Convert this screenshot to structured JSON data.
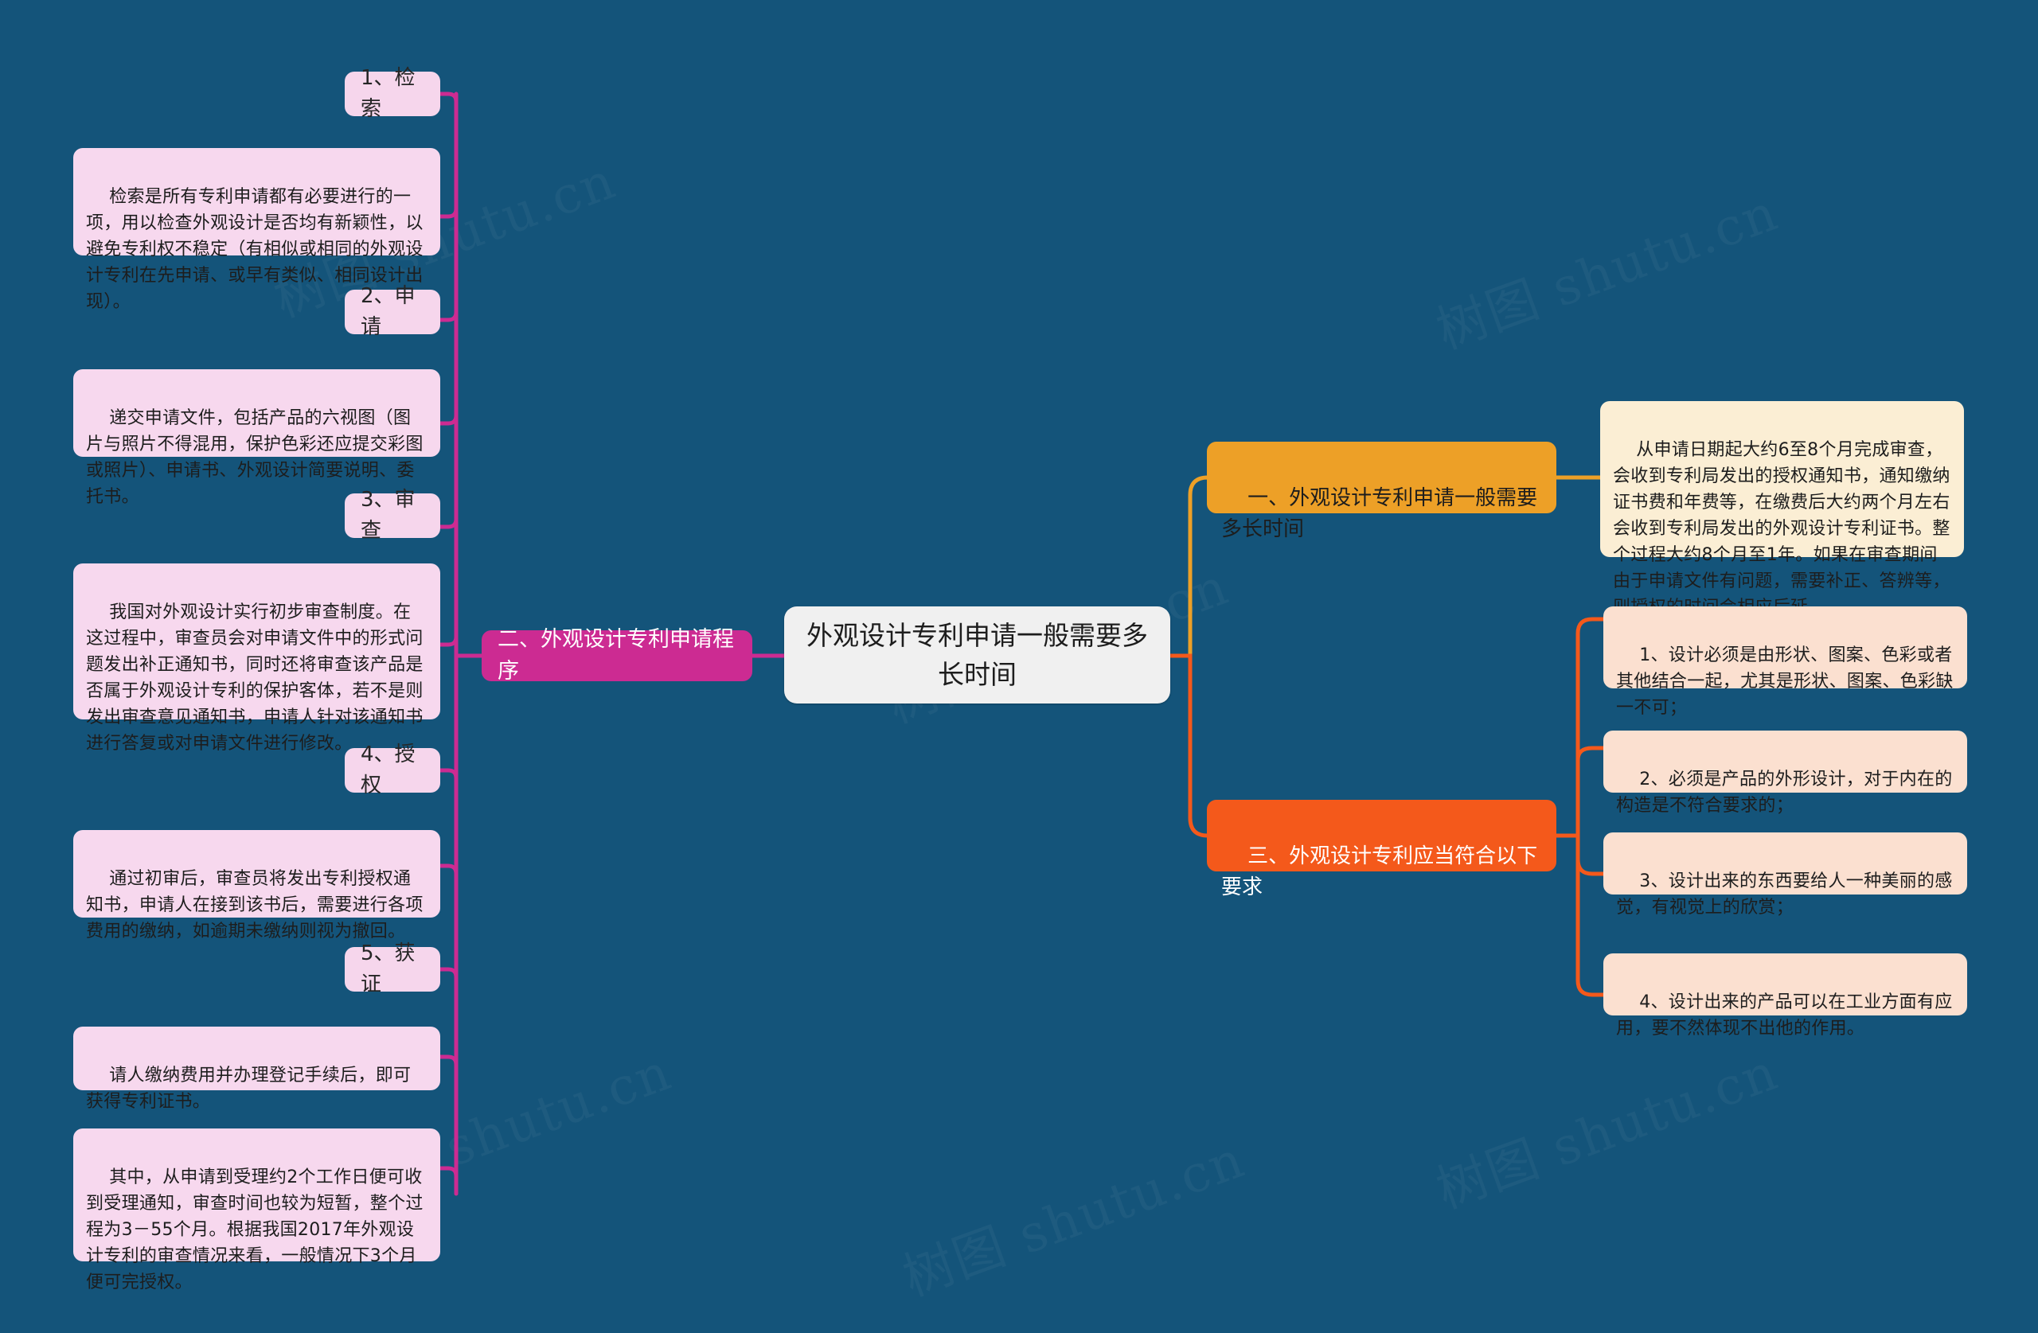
{
  "theme": {
    "background": "#14547a",
    "root_bg": "#f0f0f0",
    "magenta": "#cc2b92",
    "pink_label_bg": "#f6d6ec",
    "pink_body_bg": "#f7d8ee",
    "amber": "#eda027",
    "orange": "#f4591b",
    "cream_bg": "#fbeed4",
    "peach_bg": "#fbe0d0",
    "link_magenta": "#cc2b92",
    "link_amber": "#eda027",
    "link_orange": "#f4591b"
  },
  "watermarks": [
    "树图 shutu.cn",
    "树图 shutu.cn",
    "树图 shutu.cn",
    "树图 shutu.cn",
    "树图 shutu.cn",
    "树图 shutu.cn"
  ],
  "root": {
    "label": "外观设计专利申请一般需要多长时间"
  },
  "left_branch": {
    "label": "二、外观设计专利申请程序",
    "steps": [
      {
        "label": "1、检索",
        "body": "检索是所有专利申请都有必要进行的一项，用以检查外观设计是否均有新颖性，以避免专利权不稳定（有相似或相同的外观设计专利在先申请、或早有类似、相同设计出现）。"
      },
      {
        "label": "2、申请",
        "body": "递交申请文件，包括产品的六视图（图片与照片不得混用，保护色彩还应提交彩图或照片）、申请书、外观设计简要说明、委托书。"
      },
      {
        "label": "3、审查",
        "body": "我国对外观设计实行初步审查制度。在这过程中，审查员会对申请文件中的形式问题发出补正通知书，同时还将审查该产品是否属于外观设计专利的保护客体，若不是则发出审查意见通知书，申请人针对该通知书进行答复或对申请文件进行修改。"
      },
      {
        "label": "4、授权",
        "body": "通过初审后，审查员将发出专利授权通知书，申请人在接到该书后，需要进行各项费用的缴纳，如逾期未缴纳则视为撤回。"
      },
      {
        "label": "5、获证",
        "body": "请人缴纳费用并办理登记手续后，即可获得专利证书。"
      }
    ],
    "closing_note": "其中，从申请到受理约2个工作日便可收到受理通知，审查时间也较为短暂，整个过程为3－55个月。根据我国2017年外观设计专利的审查情况来看，一般情况下3个月便可完授权。"
  },
  "right_branches": [
    {
      "label": "一、外观设计专利申请一般需要多长时间",
      "children": [
        "从申请日期起大约6至8个月完成审查，会收到专利局发出的授权通知书，通知缴纳证书费和年费等，在缴费后大约两个月左右会收到专利局发出的外观设计专利证书。整个过程大约8个月至1年。如果在审查期间由于申请文件有问题，需要补正、答辨等，则授权的时间会相应后延。"
      ]
    },
    {
      "label": "三、外观设计专利应当符合以下要求",
      "children": [
        "1、设计必须是由形状、图案、色彩或者其他结合一起，尤其是形状、图案、色彩缺一不可；",
        "2、必须是产品的外形设计，对于内在的构造是不符合要求的；",
        "3、设计出来的东西要给人一种美丽的感觉，有视觉上的欣赏；",
        "4、设计出来的产品可以在工业方面有应用，要不然体现不出他的作用。"
      ]
    }
  ]
}
